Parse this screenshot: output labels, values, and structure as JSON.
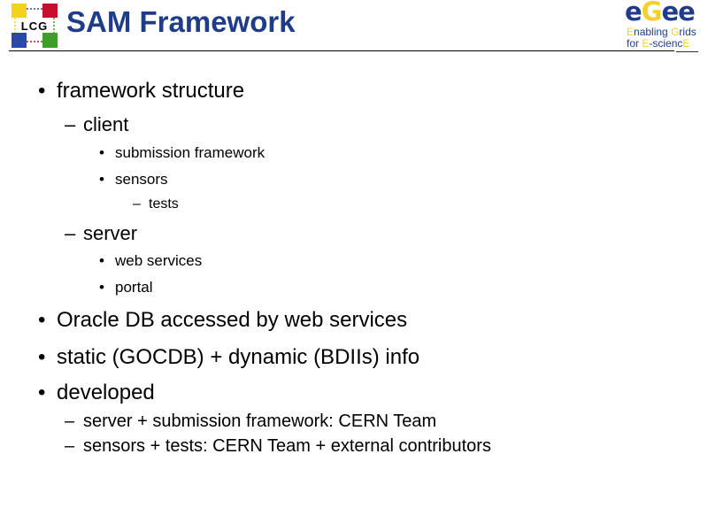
{
  "slide": {
    "title": "SAM Framework",
    "logos": {
      "left": {
        "text": "LCG",
        "colors": {
          "top_left": "#f2d21b",
          "top_right": "#c8102e",
          "bottom_left": "#2a4aa5",
          "bottom_right": "#3f9e2a"
        }
      },
      "right": {
        "word": "egee",
        "tagline_line1_prefix": "E",
        "tagline_line1_mid": "nabling ",
        "tagline_line1_g": "G",
        "tagline_line1_rest": "rids",
        "tagline_line2_prefix": "for ",
        "tagline_line2_e1": "E",
        "tagline_line2_mid": "-scienc",
        "tagline_line2_e2": "E"
      }
    },
    "bullets": [
      {
        "level": 1,
        "marker": "•",
        "text": "framework structure"
      },
      {
        "level": 2,
        "marker": "–",
        "text": "client"
      },
      {
        "level": 3,
        "marker": "•",
        "text": "submission framework"
      },
      {
        "level": 3,
        "marker": "•",
        "text": "sensors"
      },
      {
        "level": 4,
        "marker": "–",
        "text": "tests"
      },
      {
        "level": 2,
        "marker": "–",
        "text": "server"
      },
      {
        "level": 3,
        "marker": "•",
        "text": "web services"
      },
      {
        "level": 3,
        "marker": "•",
        "text": "portal"
      },
      {
        "level": 1,
        "marker": "•",
        "text": "Oracle DB accessed by web services"
      },
      {
        "level": 1,
        "marker": "•",
        "text": "static (GOCDB) + dynamic (BDIIs) info"
      },
      {
        "level": 1,
        "marker": "•",
        "text": "developed"
      },
      {
        "level": 2,
        "marker": "–",
        "text": "server + submission framework: CERN Team"
      },
      {
        "level": 2,
        "marker": "–",
        "text": "sensors + tests: CERN Team + external contributors"
      }
    ],
    "colors": {
      "title": "#1f3c88",
      "text": "#000000",
      "accent_yellow": "#f5d02a"
    }
  }
}
